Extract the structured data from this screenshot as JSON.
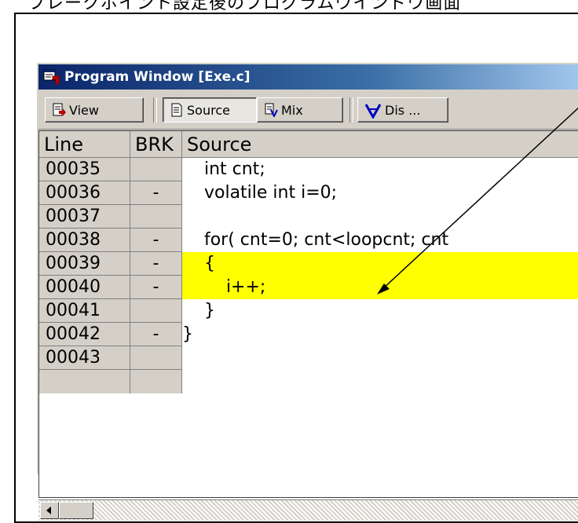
{
  "caption": "ブレークポイント設定後のプログラムウインドウ画面",
  "window": {
    "title": "Program Window [Exe.c]"
  },
  "toolbar": {
    "view_label": "View",
    "source_label": "Source",
    "mix_label": "Mix",
    "dis_label": "Dis ..."
  },
  "grid": {
    "headers": {
      "line": "Line",
      "brk": "BRK",
      "source": "Source"
    },
    "rows": [
      {
        "line": "00035",
        "brk": "",
        "source": "    int cnt;",
        "highlight": false
      },
      {
        "line": "00036",
        "brk": "-",
        "source": "    volatile int i=0;",
        "highlight": false
      },
      {
        "line": "00037",
        "brk": "",
        "source": "",
        "highlight": false
      },
      {
        "line": "00038",
        "brk": "-",
        "source": "    for( cnt=0; cnt<loopcnt; cnt",
        "highlight": false
      },
      {
        "line": "00039",
        "brk": "-",
        "source": "    {",
        "highlight": true
      },
      {
        "line": "00040",
        "brk": "-",
        "source": "        i++;",
        "highlight": true
      },
      {
        "line": "00041",
        "brk": "",
        "source": "    }",
        "highlight": false
      },
      {
        "line": "00042",
        "brk": "-",
        "source": "}",
        "highlight": false
      },
      {
        "line": "00043",
        "brk": "",
        "source": "",
        "highlight": false
      }
    ]
  },
  "colors": {
    "highlight": "#ffff00",
    "title_bar": "#0a246a",
    "annotation_arrow": "#000000"
  }
}
